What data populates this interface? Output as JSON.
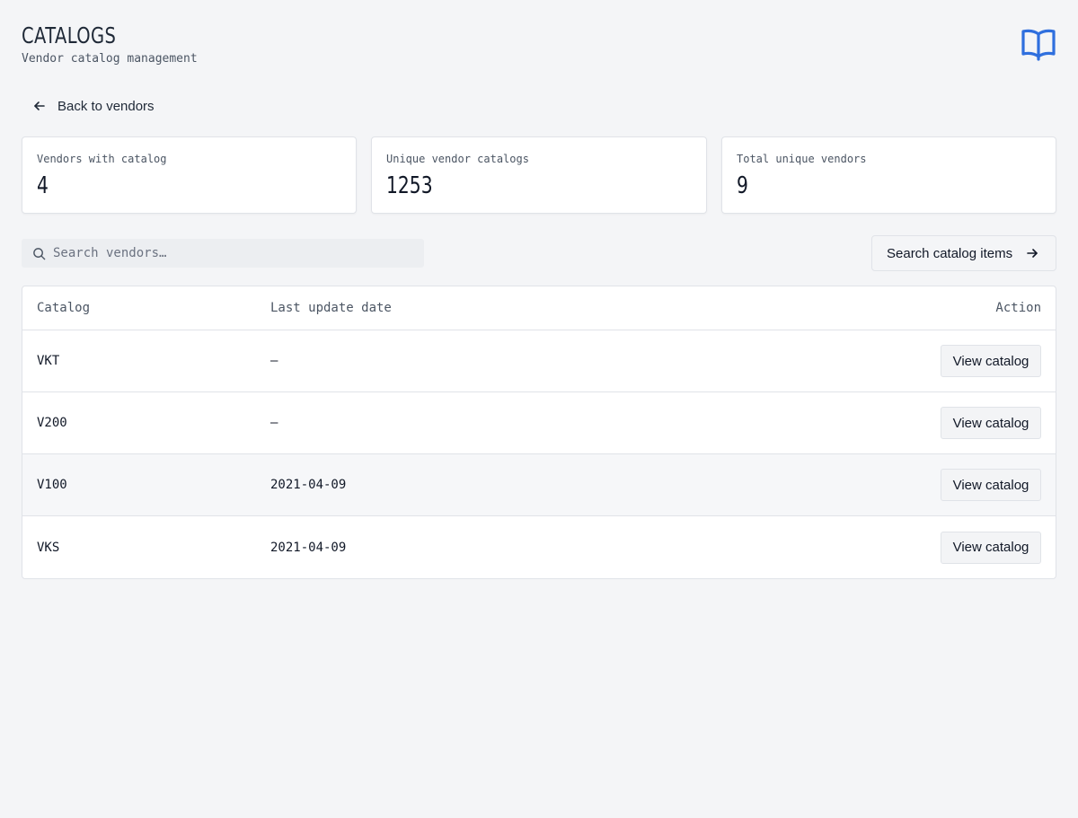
{
  "header": {
    "title": "CATALOGS",
    "subtitle": "Vendor catalog management",
    "logo_icon": "open-book-icon",
    "accent_color": "#2f6fde"
  },
  "back_link": {
    "label": "Back to vendors",
    "icon": "arrow-left-icon"
  },
  "stats": [
    {
      "label": "Vendors with catalog",
      "value": "4"
    },
    {
      "label": "Unique vendor catalogs",
      "value": "1253"
    },
    {
      "label": "Total unique vendors",
      "value": "9"
    }
  ],
  "search": {
    "placeholder": "Search vendors…",
    "value": "",
    "icon": "search-icon"
  },
  "search_items_button": {
    "label": "Search catalog items",
    "icon": "arrow-right-icon"
  },
  "table": {
    "columns": [
      "Catalog",
      "Last update date",
      "Action"
    ],
    "rows": [
      {
        "catalog": "VKT",
        "last_update": "—",
        "action": "View catalog"
      },
      {
        "catalog": "V200",
        "last_update": "—",
        "action": "View catalog"
      },
      {
        "catalog": "V100",
        "last_update": "2021-04-09",
        "action": "View catalog"
      },
      {
        "catalog": "VKS",
        "last_update": "2021-04-09",
        "action": "View catalog"
      }
    ]
  }
}
